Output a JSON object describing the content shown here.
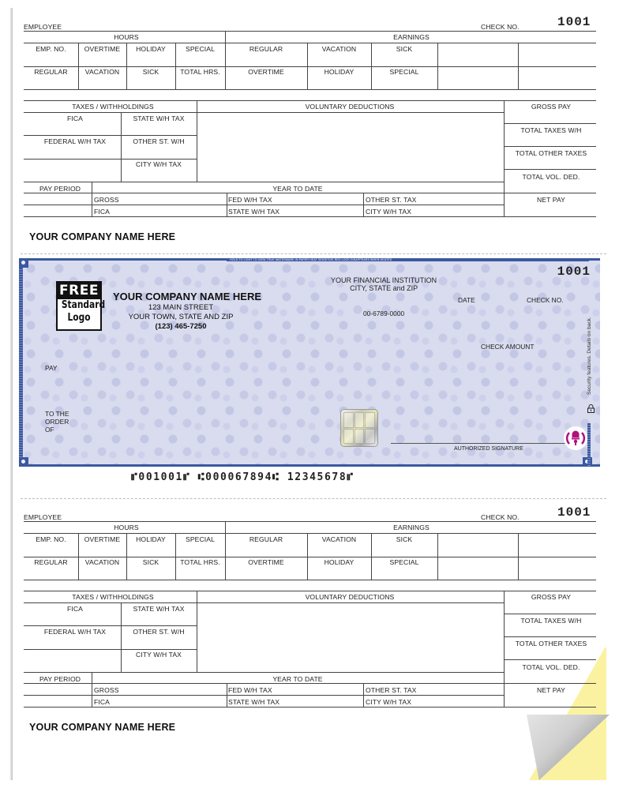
{
  "stub": {
    "employee_label": "EMPLOYEE",
    "check_no_label": "CHECK NO.",
    "check_no_value": "1001",
    "hours_header": "HOURS",
    "earnings_header": "EARNINGS",
    "hours_row1": [
      "EMP. NO.",
      "OVERTIME",
      "HOLIDAY",
      "SPECIAL"
    ],
    "hours_row2": [
      "REGULAR",
      "VACATION",
      "SICK",
      "TOTAL HRS."
    ],
    "earnings_row1": [
      "REGULAR",
      "VACATION",
      "SICK",
      "",
      ""
    ],
    "earnings_row2": [
      "OVERTIME",
      "HOLIDAY",
      "SPECIAL",
      "",
      ""
    ],
    "taxes_header": "TAXES / WITHHOLDINGS",
    "voluntary_header": "VOLUNTARY DEDUCTIONS",
    "taxes_left": [
      "FICA",
      "FEDERAL W/H TAX",
      ""
    ],
    "taxes_right": [
      "STATE W/H TAX",
      "OTHER ST. W/H",
      "CITY W/H TAX"
    ],
    "totals": [
      "GROSS PAY",
      "TOTAL TAXES W/H",
      "TOTAL OTHER TAXES",
      "TOTAL VOL. DED.",
      "NET PAY"
    ],
    "pay_period_label": "PAY PERIOD",
    "ytd_header": "YEAR TO DATE",
    "ytd_row1": [
      "GROSS",
      "FED W/H TAX",
      "OTHER ST. TAX"
    ],
    "ytd_row2": [
      "FICA",
      "STATE W/H TAX",
      "CITY W/H TAX"
    ],
    "company_name": "YOUR COMPANY NAME HERE"
  },
  "check": {
    "strip_text": "HOLD TO LIGHT TO VIEW TRUE WATERMARK IN PAPER    HEAT SENSITIVE RED LOCK DISAPPEARS WHEN HEATED",
    "logo_line1": "FREE",
    "logo_line2": "Standard",
    "logo_line3": "Logo",
    "company_name": "YOUR COMPANY NAME HERE",
    "address_line1": "123 MAIN STREET",
    "address_line2": "YOUR TOWN, STATE AND ZIP",
    "phone": "(123) 465-7250",
    "bank_name": "YOUR FINANCIAL INSTITUTION",
    "bank_city": "CITY, STATE and ZIP",
    "routing_fraction": "00-6789-0000",
    "date_label": "DATE",
    "check_no_label": "CHECK NO.",
    "check_no_value": "1001",
    "check_amount_label": "CHECK AMOUNT",
    "pay_label": "PAY",
    "order_line1": "TO THE",
    "order_line2": "ORDER",
    "order_line3": "OF",
    "signature_label": "AUTHORIZED SIGNATURE",
    "security_text": "Security features. Details on back.",
    "micr": "⑈001001⑈ ⑆000067894⑆ 12345678⑈",
    "border_color": "#3b58a0",
    "lock_color": "#b0107a"
  }
}
